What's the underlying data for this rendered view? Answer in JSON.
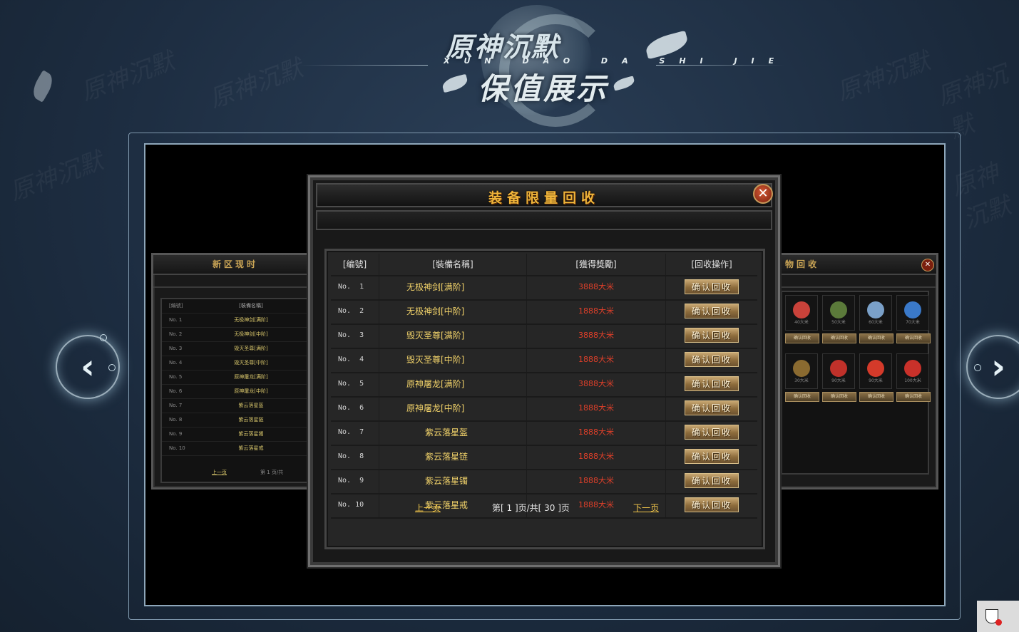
{
  "banner": {
    "title_top": "原神沉默",
    "pinyin": "XUN DAO DA SHI JIE",
    "title_bottom": "保值展示"
  },
  "watermark_text": "原神沉默",
  "modal": {
    "title": "装备限量回收",
    "close_label": "✕",
    "columns": [
      "[编號]",
      "[裝備名稱]",
      "[獲得獎勵]",
      "[回收操作]"
    ],
    "action_label": "确认回收",
    "rows": [
      {
        "no": "No.  1",
        "name": "无极神剑[满阶]",
        "reward": "3888大米"
      },
      {
        "no": "No.  2",
        "name": "无极神剑[中阶]",
        "reward": "1888大米"
      },
      {
        "no": "No.  3",
        "name": "毁灭圣尊[满阶]",
        "reward": "3888大米"
      },
      {
        "no": "No.  4",
        "name": "毁灭圣尊[中阶]",
        "reward": "1888大米"
      },
      {
        "no": "No.  5",
        "name": "原神屠龙[满阶]",
        "reward": "3888大米"
      },
      {
        "no": "No.  6",
        "name": "原神屠龙[中阶]",
        "reward": "1888大米"
      },
      {
        "no": "No.  7",
        "name": "紫云落星盔",
        "reward": "1888大米"
      },
      {
        "no": "No.  8",
        "name": "紫云落星链",
        "reward": "1888大米"
      },
      {
        "no": "No.  9",
        "name": "紫云落星镯",
        "reward": "1888大米"
      },
      {
        "no": "No. 10",
        "name": "紫云落星戒",
        "reward": "1888大米"
      }
    ],
    "pager": {
      "prev": "上一页",
      "info": "第[ 1 ]页/共[ 30 ]页",
      "next": "下一页"
    }
  },
  "left_panel": {
    "title": "新区现时",
    "header": [
      "[编號]",
      "[裝備名稱]"
    ],
    "rows": [
      {
        "no": "No. 1",
        "name": "无极神剑[满阶]"
      },
      {
        "no": "No. 2",
        "name": "无极神剑[中阶]"
      },
      {
        "no": "No. 3",
        "name": "毁灭圣尊[满阶]"
      },
      {
        "no": "No. 4",
        "name": "毁灭圣尊[中阶]"
      },
      {
        "no": "No. 5",
        "name": "原神屠龙[满阶]"
      },
      {
        "no": "No. 6",
        "name": "原神屠龙[中阶]"
      },
      {
        "no": "No. 7",
        "name": "紫云落星盔"
      },
      {
        "no": "No. 8",
        "name": "紫云落星链"
      },
      {
        "no": "No. 9",
        "name": "紫云落星镯"
      },
      {
        "no": "No. 10",
        "name": "紫云落星戒"
      }
    ],
    "prev": "上一页",
    "info": "第 1 页/共"
  },
  "right_panel": {
    "title": "物回收",
    "items_row1": [
      "40大米",
      "50大米",
      "60大米",
      "70大米"
    ],
    "items_row2": [
      "30大米",
      "90大米",
      "90大米",
      "100大米"
    ],
    "button_label": "确认回收"
  },
  "colors": {
    "gold": "#f0b43a",
    "reward_red": "#e0402a",
    "name_yellow": "#f2d36a"
  }
}
